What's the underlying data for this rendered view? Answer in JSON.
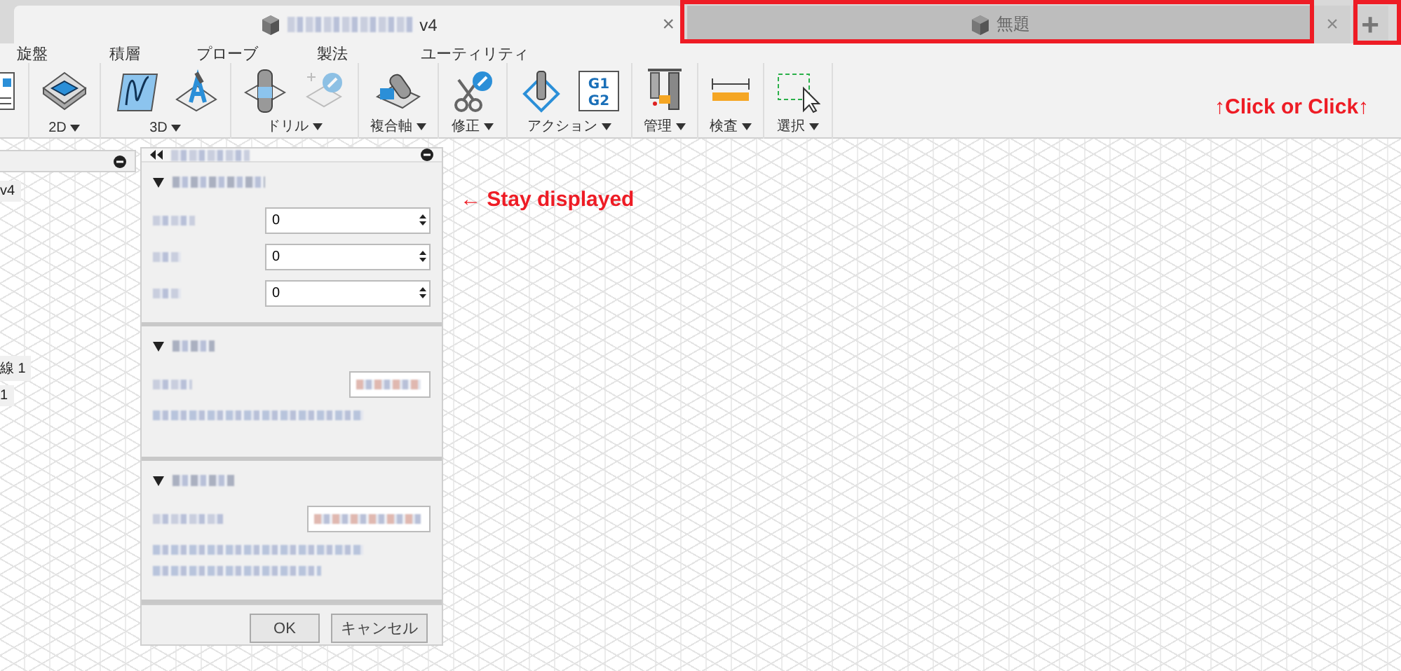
{
  "tabs": [
    {
      "title": "v4",
      "selected": true,
      "close": "×"
    },
    {
      "title": "無題",
      "selected": false,
      "close": "×"
    }
  ],
  "new_tab_button": "+",
  "menu": [
    "旋盤",
    "積層",
    "プローブ",
    "製法",
    "ユーティリティ"
  ],
  "toolbar_groups": [
    {
      "cut_off": true
    },
    {
      "label": "2D"
    },
    {
      "label": "3D"
    },
    {
      "label": "ドリル"
    },
    {
      "label": "複合軸"
    },
    {
      "label": "修正"
    },
    {
      "label": "アクション",
      "icon_text": [
        "G1",
        "G2"
      ]
    },
    {
      "label": "管理"
    },
    {
      "label": "検査"
    },
    {
      "label": "選択"
    }
  ],
  "browser_items": [
    "v4",
    "線 1",
    "1"
  ],
  "dialog": {
    "sections": [
      {
        "expanded": true,
        "fields": [
          {
            "kind": "number",
            "value": "0"
          },
          {
            "kind": "number",
            "value": "0"
          },
          {
            "kind": "number",
            "value": "0"
          }
        ]
      },
      {
        "expanded": true,
        "fields": [
          {
            "kind": "blurred"
          }
        ]
      },
      {
        "expanded": true,
        "fields": [
          {
            "kind": "blurred"
          }
        ]
      }
    ],
    "buttons": [
      "OK",
      "キャンセル"
    ]
  },
  "annotations": [
    "↑Click or Click↑",
    "← Stay displayed"
  ]
}
